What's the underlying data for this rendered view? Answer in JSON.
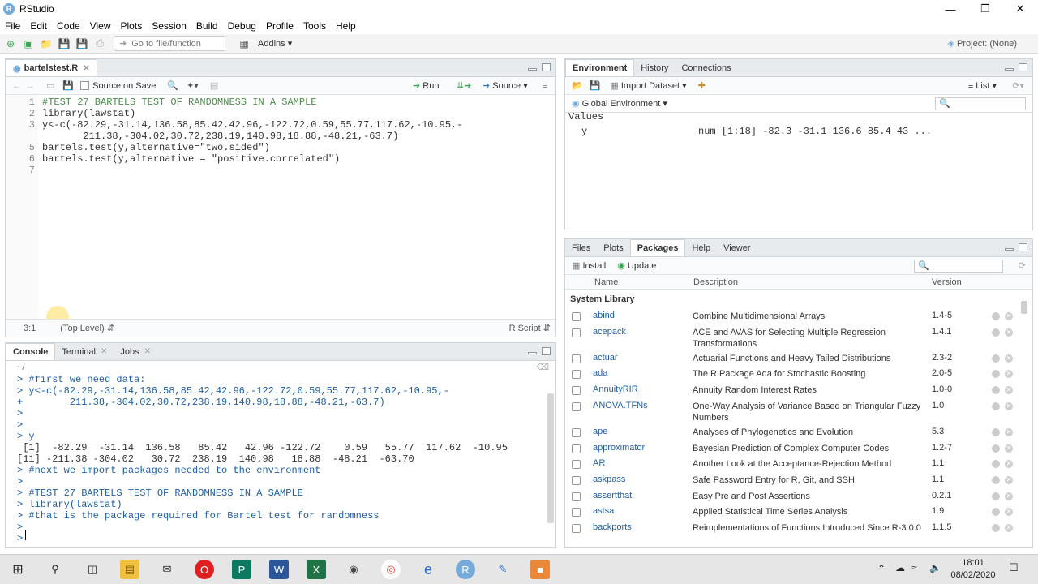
{
  "app": {
    "title": "RStudio",
    "project": "Project: (None)"
  },
  "menu": [
    "File",
    "Edit",
    "Code",
    "View",
    "Plots",
    "Session",
    "Build",
    "Debug",
    "Profile",
    "Tools",
    "Help"
  ],
  "toolbar": {
    "goto_placeholder": "Go to file/function",
    "addins": "Addins"
  },
  "editor": {
    "tab": "bartelstest.R",
    "source_on_save": "Source on Save",
    "run": "Run",
    "source": "Source",
    "lines": [
      {
        "n": "1",
        "text": "#TEST 27 BARTELS TEST OF RANDOMNESS IN A SAMPLE"
      },
      {
        "n": "2",
        "text": "library(lawstat)"
      },
      {
        "n": "3",
        "text": "y<-c(-82.29,-31.14,136.58,85.42,42.96,-122.72,0.59,55.77,117.62,-10.95,-"
      },
      {
        "n": "",
        "text": "       211.38,-304.02,30.72,238.19,140.98,18.88,-48.21,-63.7)"
      },
      {
        "n": "5",
        "text": "bartels.test(y,alternative=\"two.sided\")"
      },
      {
        "n": "6",
        "text": "bartels.test(y,alternative = \"positive.correlated\")"
      },
      {
        "n": "7",
        "text": ""
      }
    ],
    "status_pos": "3:1",
    "status_scope": "(Top Level)",
    "status_type": "R Script"
  },
  "console": {
    "tabs": [
      "Console",
      "Terminal",
      "Jobs"
    ],
    "path": "~/",
    "lines": [
      {
        "p": "> ",
        "text": "#first we need data:",
        "cls": "echo"
      },
      {
        "p": "> ",
        "text": "y<-c(-82.29,-31.14,136.58,85.42,42.96,-122.72,0.59,55.77,117.62,-10.95,-",
        "cls": "echo"
      },
      {
        "p": "+ ",
        "text": "       211.38,-304.02,30.72,238.19,140.98,18.88,-48.21,-63.7)",
        "cls": "echo"
      },
      {
        "p": "> ",
        "text": "",
        "cls": "echo"
      },
      {
        "p": "> ",
        "text": "",
        "cls": "echo"
      },
      {
        "p": "> ",
        "text": "y",
        "cls": "echo"
      },
      {
        "p": "",
        "text": " [1]  -82.29  -31.14  136.58   85.42   42.96 -122.72    0.59   55.77  117.62  -10.95",
        "cls": "out"
      },
      {
        "p": "",
        "text": "[11] -211.38 -304.02   30.72  238.19  140.98   18.88  -48.21  -63.70",
        "cls": "out"
      },
      {
        "p": "> ",
        "text": "#next we import packages needed to the environment",
        "cls": "echo"
      },
      {
        "p": "> ",
        "text": "",
        "cls": "echo"
      },
      {
        "p": "> ",
        "text": "#TEST 27 BARTELS TEST OF RANDOMNESS IN A SAMPLE",
        "cls": "echo"
      },
      {
        "p": "> ",
        "text": "library(lawstat)",
        "cls": "echo"
      },
      {
        "p": "> ",
        "text": "#that is the package required for Bartel test for randomness",
        "cls": "echo"
      },
      {
        "p": "> ",
        "text": "",
        "cls": "echo"
      },
      {
        "p": "> ",
        "text": "",
        "cls": "echo"
      }
    ]
  },
  "environment": {
    "tabs": [
      "Environment",
      "History",
      "Connections"
    ],
    "import_dataset": "Import Dataset",
    "list_view": "List",
    "scope": "Global Environment",
    "section": "Values",
    "var_name": "y",
    "var_value": "num [1:18] -82.3 -31.1 136.6 85.4 43 ..."
  },
  "packages": {
    "tabs": [
      "Files",
      "Plots",
      "Packages",
      "Help",
      "Viewer"
    ],
    "install": "Install",
    "update": "Update",
    "columns": [
      "Name",
      "Description",
      "Version"
    ],
    "section": "System Library",
    "rows": [
      {
        "name": "abind",
        "desc": "Combine Multidimensional Arrays",
        "ver": "1.4-5"
      },
      {
        "name": "acepack",
        "desc": "ACE and AVAS for Selecting Multiple Regression Transformations",
        "ver": "1.4.1"
      },
      {
        "name": "actuar",
        "desc": "Actuarial Functions and Heavy Tailed Distributions",
        "ver": "2.3-2"
      },
      {
        "name": "ada",
        "desc": "The R Package Ada for Stochastic Boosting",
        "ver": "2.0-5"
      },
      {
        "name": "AnnuityRIR",
        "desc": "Annuity Random Interest Rates",
        "ver": "1.0-0"
      },
      {
        "name": "ANOVA.TFNs",
        "desc": "One-Way Analysis of Variance Based on Triangular Fuzzy Numbers",
        "ver": "1.0"
      },
      {
        "name": "ape",
        "desc": "Analyses of Phylogenetics and Evolution",
        "ver": "5.3"
      },
      {
        "name": "approximator",
        "desc": "Bayesian Prediction of Complex Computer Codes",
        "ver": "1.2-7"
      },
      {
        "name": "AR",
        "desc": "Another Look at the Acceptance-Rejection Method",
        "ver": "1.1"
      },
      {
        "name": "askpass",
        "desc": "Safe Password Entry for R, Git, and SSH",
        "ver": "1.1"
      },
      {
        "name": "assertthat",
        "desc": "Easy Pre and Post Assertions",
        "ver": "0.2.1"
      },
      {
        "name": "astsa",
        "desc": "Applied Statistical Time Series Analysis",
        "ver": "1.9"
      },
      {
        "name": "backports",
        "desc": "Reimplementations of Functions Introduced Since R-3.0.0",
        "ver": "1.1.5"
      }
    ]
  },
  "taskbar": {
    "time": "18:01",
    "date": "08/02/2020"
  },
  "colors": {
    "accent": "#75aadb",
    "code_blue": "#1f5fa6",
    "string_green": "#2a9d2a"
  }
}
